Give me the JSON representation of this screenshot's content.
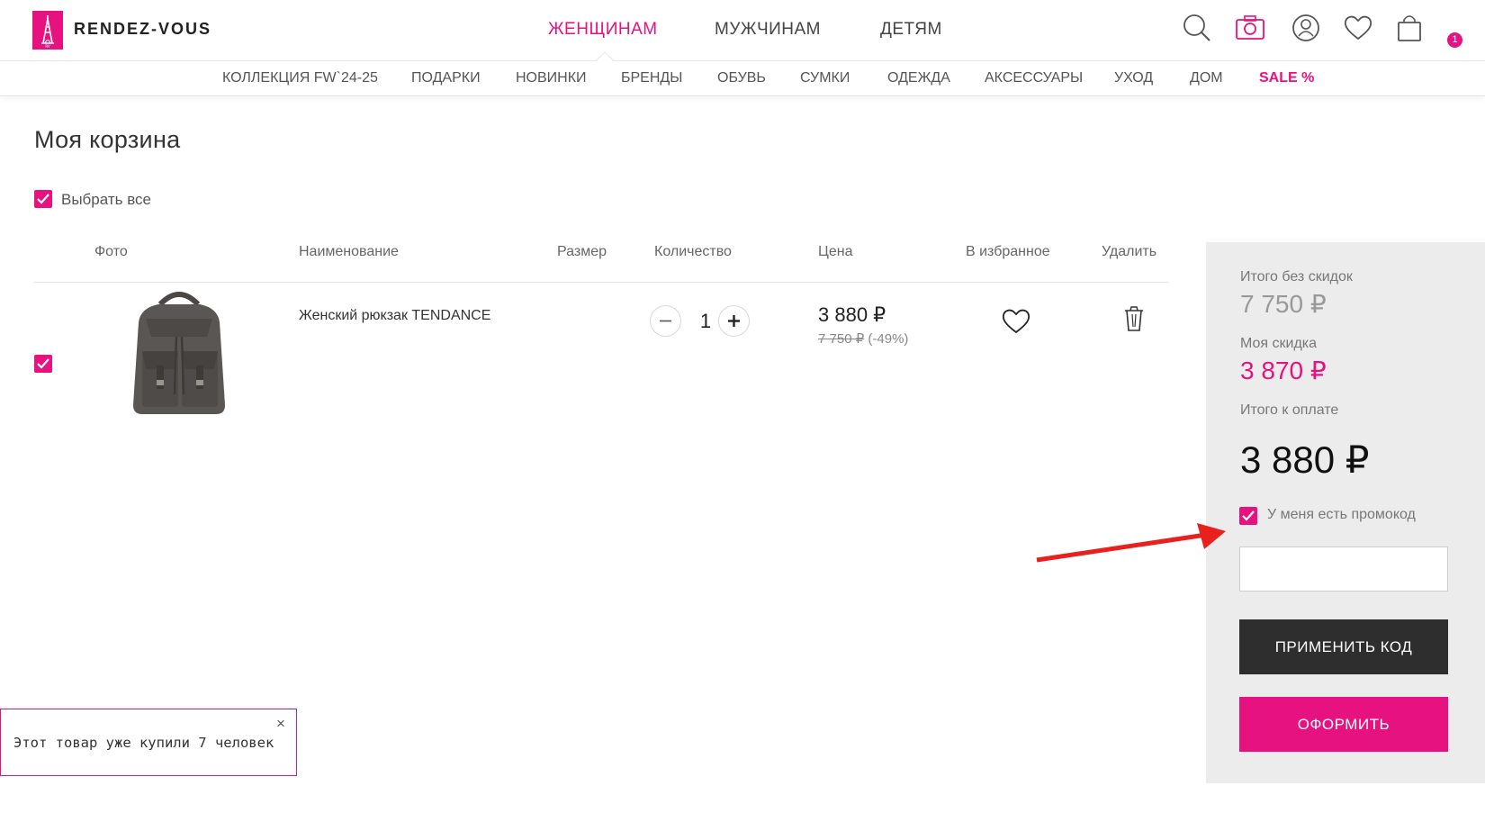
{
  "header": {
    "brand": "RENDEZ-VOUS",
    "nav": [
      {
        "label": "ЖЕНЩИНАМ",
        "active": true
      },
      {
        "label": "МУЖЧИНАМ",
        "active": false
      },
      {
        "label": "ДЕТЯМ",
        "active": false
      }
    ],
    "icons": [
      "search-icon",
      "camera-icon",
      "user-icon",
      "heart-icon",
      "cart-icon"
    ],
    "cart_count": "1",
    "accent_color": "#e6127f"
  },
  "subnav": [
    "КОЛЛЕКЦИЯ FW`24-25",
    "ПОДАРКИ",
    "НОВИНКИ",
    "БРЕНДЫ",
    "ОБУВЬ",
    "СУМКИ",
    "ОДЕЖДА",
    "АКСЕССУАРЫ",
    "УХОД",
    "ДОМ",
    "SALE %"
  ],
  "page": {
    "title": "Моя корзина",
    "select_all": "Выбрать все"
  },
  "table": {
    "columns": [
      "Фото",
      "Наименование",
      "Размер",
      "Количество",
      "Цена",
      "В избранное",
      "Удалить"
    ],
    "items": [
      {
        "name": "Женский рюкзак TENDANCE",
        "size": "",
        "quantity": "1",
        "price": "3 880 ₽",
        "old_price": "7 750 ₽",
        "discount": "(-49%)",
        "checked": true
      }
    ]
  },
  "summary": {
    "subtotal_label": "Итого без скидок",
    "subtotal_value": "7 750 ₽",
    "discount_label": "Моя скидка",
    "discount_value": "3 870 ₽",
    "total_label": "Итого к оплате",
    "total_value": "3 880 ₽",
    "promo_label": "У меня есть промокод",
    "promo_value": "",
    "apply_button": "ПРИМЕНИТЬ КОД",
    "checkout_button": "ОФОРМИТЬ"
  },
  "toast": {
    "text": "Этот товар уже купили 7 человек",
    "close": "×"
  }
}
